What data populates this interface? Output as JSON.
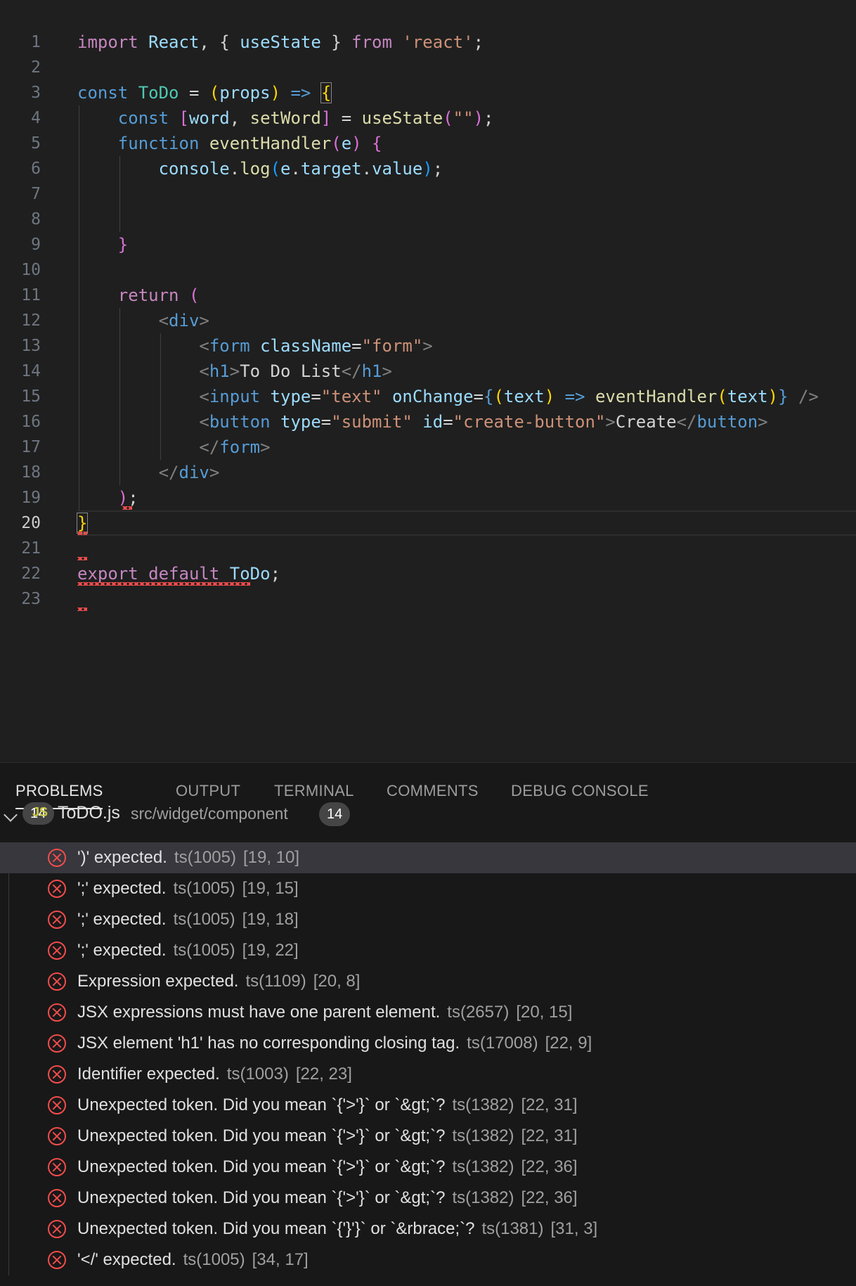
{
  "editor": {
    "lines": [
      {
        "n": "1",
        "tokens": [
          [
            "k",
            "import"
          ],
          [
            "p",
            " "
          ],
          [
            "v",
            "React"
          ],
          [
            "p",
            ", { "
          ],
          [
            "v",
            "useState"
          ],
          [
            "p",
            " } "
          ],
          [
            "k",
            "from"
          ],
          [
            "p",
            " "
          ],
          [
            "str",
            "'react'"
          ],
          [
            "p",
            ";"
          ]
        ]
      },
      {
        "n": "2",
        "tokens": []
      },
      {
        "n": "3",
        "tokens": [
          [
            "s",
            "const"
          ],
          [
            "p",
            " "
          ],
          [
            "c",
            "ToDo"
          ],
          [
            "p",
            " = "
          ],
          [
            "b",
            "("
          ],
          [
            "v",
            "props"
          ],
          [
            "b",
            ")"
          ],
          [
            "p",
            " "
          ],
          [
            "s",
            "=>"
          ],
          [
            "p",
            " "
          ],
          [
            "b",
            "{"
          ]
        ]
      },
      {
        "n": "4",
        "tokens": [
          [
            "p",
            "    "
          ],
          [
            "s",
            "const"
          ],
          [
            "p",
            " "
          ],
          [
            "b2",
            "["
          ],
          [
            "v",
            "word"
          ],
          [
            "p",
            ", "
          ],
          [
            "f",
            "setWord"
          ],
          [
            "b2",
            "]"
          ],
          [
            "p",
            " = "
          ],
          [
            "f",
            "useState"
          ],
          [
            "b2",
            "("
          ],
          [
            "str",
            "\"\""
          ],
          [
            "b2",
            ")"
          ],
          [
            "p",
            ";"
          ]
        ]
      },
      {
        "n": "5",
        "tokens": [
          [
            "p",
            "    "
          ],
          [
            "s",
            "function"
          ],
          [
            "p",
            " "
          ],
          [
            "f",
            "eventHandler"
          ],
          [
            "b2",
            "("
          ],
          [
            "v",
            "e"
          ],
          [
            "b2",
            ")"
          ],
          [
            "p",
            " "
          ],
          [
            "b2",
            "{"
          ]
        ]
      },
      {
        "n": "6",
        "tokens": [
          [
            "p",
            "        "
          ],
          [
            "v",
            "console"
          ],
          [
            "p",
            "."
          ],
          [
            "f",
            "log"
          ],
          [
            "b3",
            "("
          ],
          [
            "v",
            "e"
          ],
          [
            "p",
            "."
          ],
          [
            "v",
            "target"
          ],
          [
            "p",
            "."
          ],
          [
            "v",
            "value"
          ],
          [
            "b3",
            ")"
          ],
          [
            "p",
            ";"
          ]
        ]
      },
      {
        "n": "7",
        "tokens": []
      },
      {
        "n": "8",
        "tokens": []
      },
      {
        "n": "9",
        "tokens": [
          [
            "p",
            "    "
          ],
          [
            "b2",
            "}"
          ]
        ]
      },
      {
        "n": "10",
        "tokens": []
      },
      {
        "n": "11",
        "tokens": [
          [
            "p",
            "    "
          ],
          [
            "k",
            "return"
          ],
          [
            "p",
            " "
          ],
          [
            "b2",
            "("
          ]
        ]
      },
      {
        "n": "12",
        "tokens": [
          [
            "p",
            "        "
          ],
          [
            "tg",
            "<"
          ],
          [
            "s",
            "div"
          ],
          [
            "tg",
            ">"
          ]
        ]
      },
      {
        "n": "13",
        "tokens": [
          [
            "p",
            "            "
          ],
          [
            "tg",
            "<"
          ],
          [
            "s",
            "form"
          ],
          [
            "p",
            " "
          ],
          [
            "v",
            "className"
          ],
          [
            "p",
            "="
          ],
          [
            "str",
            "\"form\""
          ],
          [
            "tg",
            ">"
          ]
        ]
      },
      {
        "n": "14",
        "tokens": [
          [
            "p",
            "            "
          ],
          [
            "tg",
            "<"
          ],
          [
            "s",
            "h1"
          ],
          [
            "tg",
            ">"
          ],
          [
            "t",
            "To Do List"
          ],
          [
            "tg",
            "</"
          ],
          [
            "s",
            "h1"
          ],
          [
            "tg",
            ">"
          ]
        ]
      },
      {
        "n": "15",
        "tokens": [
          [
            "p",
            "            "
          ],
          [
            "tg",
            "<"
          ],
          [
            "s",
            "input"
          ],
          [
            "p",
            " "
          ],
          [
            "v",
            "type"
          ],
          [
            "p",
            "="
          ],
          [
            "str",
            "\"text\""
          ],
          [
            "p",
            " "
          ],
          [
            "v",
            "onChange"
          ],
          [
            "p",
            "="
          ],
          [
            "s",
            "{"
          ],
          [
            "b",
            "("
          ],
          [
            "v",
            "text"
          ],
          [
            "b",
            ")"
          ],
          [
            "p",
            " "
          ],
          [
            "s",
            "=>"
          ],
          [
            "p",
            " "
          ],
          [
            "f",
            "eventHandler"
          ],
          [
            "b",
            "("
          ],
          [
            "v",
            "text"
          ],
          [
            "b",
            ")"
          ],
          [
            "s",
            "}"
          ],
          [
            "p",
            " "
          ],
          [
            "tg",
            "/>"
          ]
        ]
      },
      {
        "n": "16",
        "tokens": [
          [
            "p",
            "            "
          ],
          [
            "tg",
            "<"
          ],
          [
            "s",
            "button"
          ],
          [
            "p",
            " "
          ],
          [
            "v",
            "type"
          ],
          [
            "p",
            "="
          ],
          [
            "str",
            "\"submit\""
          ],
          [
            "p",
            " "
          ],
          [
            "v",
            "id"
          ],
          [
            "p",
            "="
          ],
          [
            "str",
            "\"create-button\""
          ],
          [
            "tg",
            ">"
          ],
          [
            "t",
            "Create"
          ],
          [
            "tg",
            "</"
          ],
          [
            "s",
            "button"
          ],
          [
            "tg",
            ">"
          ]
        ]
      },
      {
        "n": "17",
        "tokens": [
          [
            "p",
            "            "
          ],
          [
            "tg",
            "</"
          ],
          [
            "s",
            "form"
          ],
          [
            "tg",
            ">"
          ]
        ]
      },
      {
        "n": "18",
        "tokens": [
          [
            "p",
            "        "
          ],
          [
            "tg",
            "</"
          ],
          [
            "s",
            "div"
          ],
          [
            "tg",
            ">"
          ]
        ]
      },
      {
        "n": "19",
        "tokens": [
          [
            "p",
            "    "
          ],
          [
            "b2",
            ")"
          ],
          [
            "p",
            ";"
          ]
        ]
      },
      {
        "n": "20",
        "tokens": [
          [
            "b",
            "}"
          ]
        ]
      },
      {
        "n": "21",
        "tokens": []
      },
      {
        "n": "22",
        "tokens": [
          [
            "k",
            "export"
          ],
          [
            "p",
            " "
          ],
          [
            "k",
            "default"
          ],
          [
            "p",
            " "
          ],
          [
            "v",
            "ToDo"
          ],
          [
            "p",
            ";"
          ]
        ]
      },
      {
        "n": "23",
        "tokens": []
      }
    ],
    "current_line": "20"
  },
  "panel": {
    "tabs": [
      {
        "label": "PROBLEMS",
        "badge": "14"
      },
      {
        "label": "OUTPUT"
      },
      {
        "label": "TERMINAL"
      },
      {
        "label": "COMMENTS"
      },
      {
        "label": "DEBUG CONSOLE"
      }
    ],
    "file": {
      "icon_text": "JS",
      "name": "ToDO.js",
      "path": "src/widget/component",
      "count": "14"
    },
    "problems": [
      {
        "msg": "')' expected.",
        "code": "ts(1005)",
        "pos": "[19, 10]"
      },
      {
        "msg": "';' expected.",
        "code": "ts(1005)",
        "pos": "[19, 15]"
      },
      {
        "msg": "';' expected.",
        "code": "ts(1005)",
        "pos": "[19, 18]"
      },
      {
        "msg": "';' expected.",
        "code": "ts(1005)",
        "pos": "[19, 22]"
      },
      {
        "msg": "Expression expected.",
        "code": "ts(1109)",
        "pos": "[20, 8]"
      },
      {
        "msg": "JSX expressions must have one parent element.",
        "code": "ts(2657)",
        "pos": "[20, 15]"
      },
      {
        "msg": "JSX element 'h1' has no corresponding closing tag.",
        "code": "ts(17008)",
        "pos": "[22, 9]"
      },
      {
        "msg": "Identifier expected.",
        "code": "ts(1003)",
        "pos": "[22, 23]"
      },
      {
        "msg": "Unexpected token. Did you mean `{'>'}` or `&gt;`?",
        "code": "ts(1382)",
        "pos": "[22, 31]"
      },
      {
        "msg": "Unexpected token. Did you mean `{'>'}` or `&gt;`?",
        "code": "ts(1382)",
        "pos": "[22, 31]"
      },
      {
        "msg": "Unexpected token. Did you mean `{'>'}` or `&gt;`?",
        "code": "ts(1382)",
        "pos": "[22, 36]"
      },
      {
        "msg": "Unexpected token. Did you mean `{'>'}` or `&gt;`?",
        "code": "ts(1382)",
        "pos": "[22, 36]"
      },
      {
        "msg": "Unexpected token. Did you mean `{'}'}` or `&rbrace;`?",
        "code": "ts(1381)",
        "pos": "[31, 3]"
      },
      {
        "msg": "'</' expected.",
        "code": "ts(1005)",
        "pos": "[34, 17]"
      }
    ],
    "selected_index": 0
  },
  "colors": {
    "editor_bg": "#1f1f1f",
    "panel_bg": "#181818",
    "error": "#f14c4c",
    "selection": "#37373d"
  },
  "icons": [
    "error-circle-icon",
    "chevron-down-icon",
    "js-file-icon"
  ]
}
